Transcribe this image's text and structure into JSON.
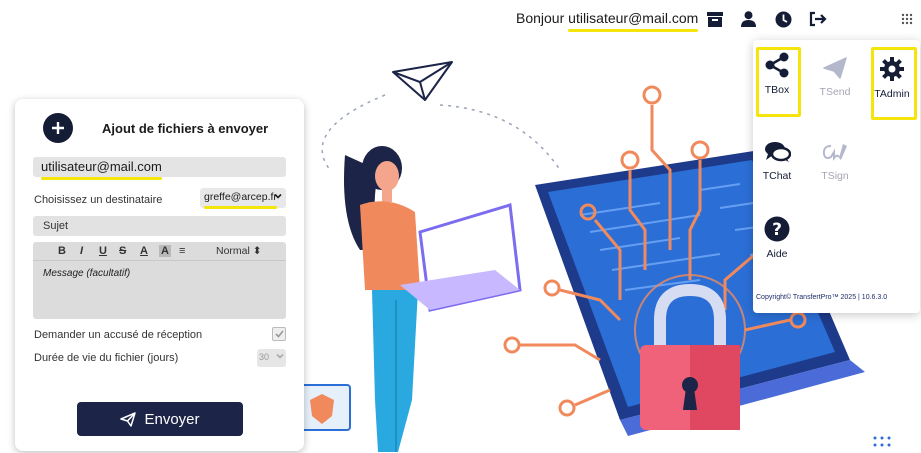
{
  "header": {
    "greeting_prefix": "Bonjour",
    "user_email": "utilisateur@mail.com",
    "highlight_color": "#f5e50c"
  },
  "icons": [
    "archive-icon",
    "user-icon",
    "history-icon",
    "logout-icon",
    "apps-grid-icon"
  ],
  "form": {
    "title": "Ajout de fichiers à envoyer",
    "sender_email": "utilisateur@mail.com",
    "recipient_label": "Choisissez un destinataire",
    "recipient_value": "greffe@arcep.fr",
    "subject_placeholder": "Sujet",
    "toolbar": {
      "bold": "B",
      "italic": "I",
      "underline": "U",
      "strike": "S",
      "font_color": "A",
      "highlight": "A",
      "align": "≡",
      "style": "Normal"
    },
    "message_placeholder": "Message (facultatif)",
    "receipt_label": "Demander un accusé de réception",
    "lifespan_label": "Durée de vie du fichier (jours)",
    "lifespan_value": "30",
    "send_label": "Envoyer"
  },
  "apps_menu": {
    "apps": [
      {
        "name": "TBox",
        "icon": "share-icon",
        "state": "active",
        "highlighted": true
      },
      {
        "name": "TSend",
        "icon": "paper-plane-icon",
        "state": "disabled",
        "highlighted": false
      },
      {
        "name": "TAdmin",
        "icon": "gear-icon",
        "state": "active",
        "highlighted": true
      },
      {
        "name": "TChat",
        "icon": "chat-icon",
        "state": "active",
        "highlighted": false
      },
      {
        "name": "TSign",
        "icon": "signature-icon",
        "state": "disabled",
        "highlighted": false
      },
      {
        "name": "Aide",
        "icon": "help-icon",
        "state": "active",
        "highlighted": false
      }
    ],
    "copyright": "Copyright© TransfertPro™ 2025 | 10.6.3.0"
  },
  "colors": {
    "primary_dark": "#141c36",
    "button": "#1c2447",
    "disabled": "#a6a6b4",
    "accent_orange": "#f08a5d",
    "screen_blue": "#2b6fd6"
  }
}
